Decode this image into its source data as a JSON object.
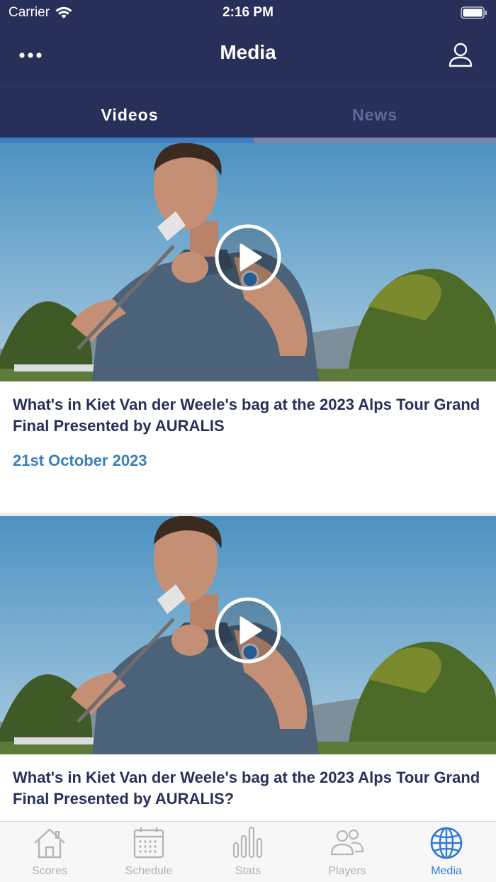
{
  "status_bar": {
    "carrier": "Carrier",
    "time": "2:16 PM"
  },
  "nav": {
    "title": "Media",
    "more_icon": "more-dots-icon",
    "profile_icon": "user-profile-icon"
  },
  "tabs": [
    {
      "label": "Videos",
      "selected": true
    },
    {
      "label": "News",
      "selected": false
    }
  ],
  "videos": [
    {
      "title": "What's in Kiet Van der Weele's bag at the 2023 Alps Tour Grand Final Presented by AURALIS",
      "date": "21st October 2023"
    },
    {
      "title": "What's in Kiet Van der Weele's bag at the 2023 Alps Tour Grand Final Presented by AURALIS?"
    }
  ],
  "tab_bar": [
    {
      "label": "Scores",
      "icon": "home-icon"
    },
    {
      "label": "Schedule",
      "icon": "calendar-icon"
    },
    {
      "label": "Stats",
      "icon": "bar-chart-icon"
    },
    {
      "label": "Players",
      "icon": "players-icon"
    },
    {
      "label": "Media",
      "icon": "globe-icon",
      "active": true
    }
  ],
  "colors": {
    "header_bg": "#28305a",
    "accent": "#3e7cc4",
    "date": "#3a7dbd",
    "active_tab": "#2f7ad4"
  }
}
